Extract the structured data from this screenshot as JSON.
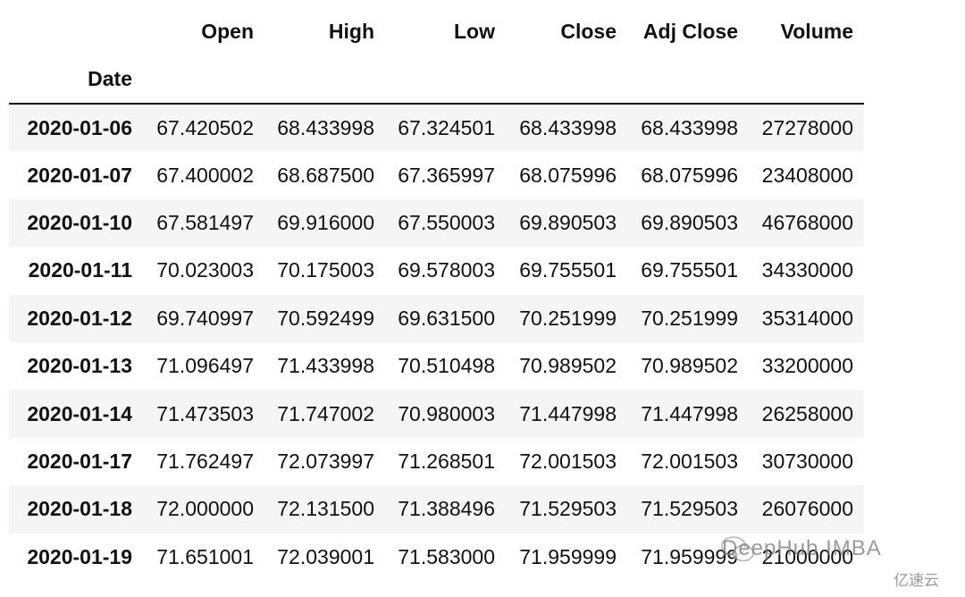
{
  "table": {
    "columns": [
      "Open",
      "High",
      "Low",
      "Close",
      "Adj Close",
      "Volume"
    ],
    "index_name": "Date",
    "rows": [
      {
        "date": "2020-01-06",
        "values": [
          "67.420502",
          "68.433998",
          "67.324501",
          "68.433998",
          "68.433998",
          "27278000"
        ]
      },
      {
        "date": "2020-01-07",
        "values": [
          "67.400002",
          "68.687500",
          "67.365997",
          "68.075996",
          "68.075996",
          "23408000"
        ]
      },
      {
        "date": "2020-01-10",
        "values": [
          "67.581497",
          "69.916000",
          "67.550003",
          "69.890503",
          "69.890503",
          "46768000"
        ]
      },
      {
        "date": "2020-01-11",
        "values": [
          "70.023003",
          "70.175003",
          "69.578003",
          "69.755501",
          "69.755501",
          "34330000"
        ]
      },
      {
        "date": "2020-01-12",
        "values": [
          "69.740997",
          "70.592499",
          "69.631500",
          "70.251999",
          "70.251999",
          "35314000"
        ]
      },
      {
        "date": "2020-01-13",
        "values": [
          "71.096497",
          "71.433998",
          "70.510498",
          "70.989502",
          "70.989502",
          "33200000"
        ]
      },
      {
        "date": "2020-01-14",
        "values": [
          "71.473503",
          "71.747002",
          "70.980003",
          "71.447998",
          "71.447998",
          "26258000"
        ]
      },
      {
        "date": "2020-01-17",
        "values": [
          "71.762497",
          "72.073997",
          "71.268501",
          "72.001503",
          "72.001503",
          "30730000"
        ]
      },
      {
        "date": "2020-01-18",
        "values": [
          "72.000000",
          "72.131500",
          "71.388496",
          "71.529503",
          "71.529503",
          "26076000"
        ]
      },
      {
        "date": "2020-01-19",
        "values": [
          "71.651001",
          "72.039001",
          "71.583000",
          "71.959999",
          "71.959999",
          "21000000"
        ]
      }
    ]
  },
  "watermarks": {
    "primary": "DeepHub IMBA",
    "secondary": "亿速云"
  }
}
